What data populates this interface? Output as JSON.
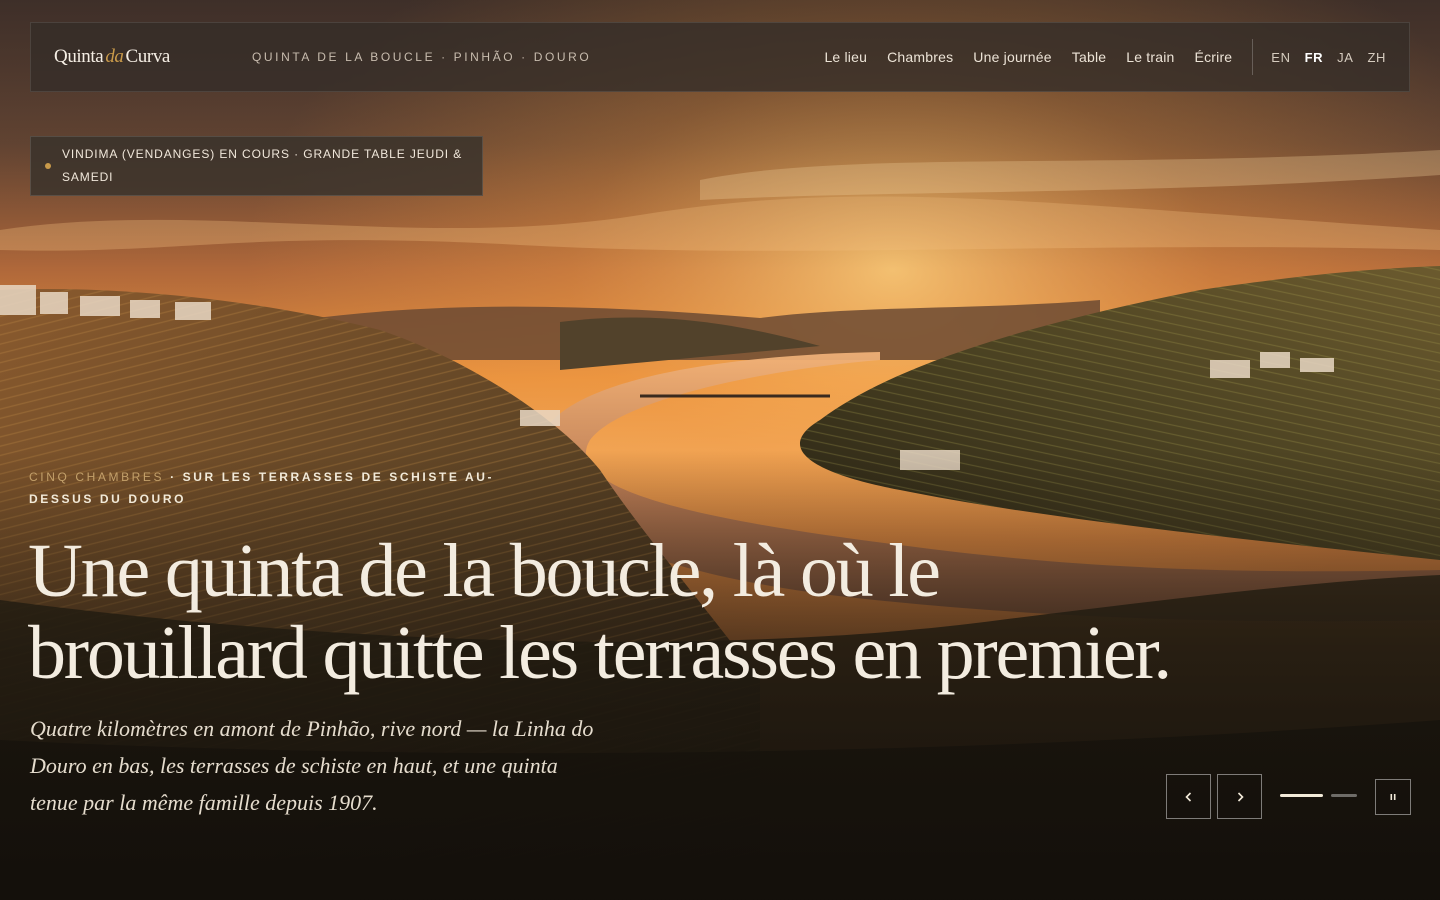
{
  "header": {
    "logo": {
      "part1": "Quinta",
      "part2": "da",
      "part3": "Curva"
    },
    "tagline": "QUINTA DE LA BOUCLE · PINHÃO · DOURO",
    "nav": [
      "Le lieu",
      "Chambres",
      "Une journée",
      "Table",
      "Le train",
      "Écrire"
    ],
    "languages": [
      "EN",
      "FR",
      "JA",
      "ZH"
    ],
    "active_language": "FR"
  },
  "notice": {
    "text": "VINDIMA (VENDANGES) EN COURS · GRANDE TABLE JEUDI & SAMEDI"
  },
  "hero": {
    "eyebrow_muted": "CINQ CHAMBRES",
    "eyebrow_rest": " · SUR LES TERRASSES DE SCHISTE AU-DESSUS DU DOURO",
    "headline_line1": "Une quinta de la boucle, là où le",
    "headline_line2": "brouillard quitte les terrasses en premier.",
    "lede": "Quatre kilomètres en amont de Pinhão, rive nord — la Linha do Douro en bas, les terrasses de schiste en haut, et une quinta tenue par la même famille depuis 1907."
  },
  "slider": {
    "slide_count": 2,
    "active_slide": 1,
    "icons": {
      "prev": "chevron-left-icon",
      "next": "chevron-right-icon",
      "pause": "pause-icon"
    }
  },
  "colors": {
    "accent_gold": "#c99a4a",
    "text_cream": "#f3ece0",
    "panel": "#342d28"
  }
}
